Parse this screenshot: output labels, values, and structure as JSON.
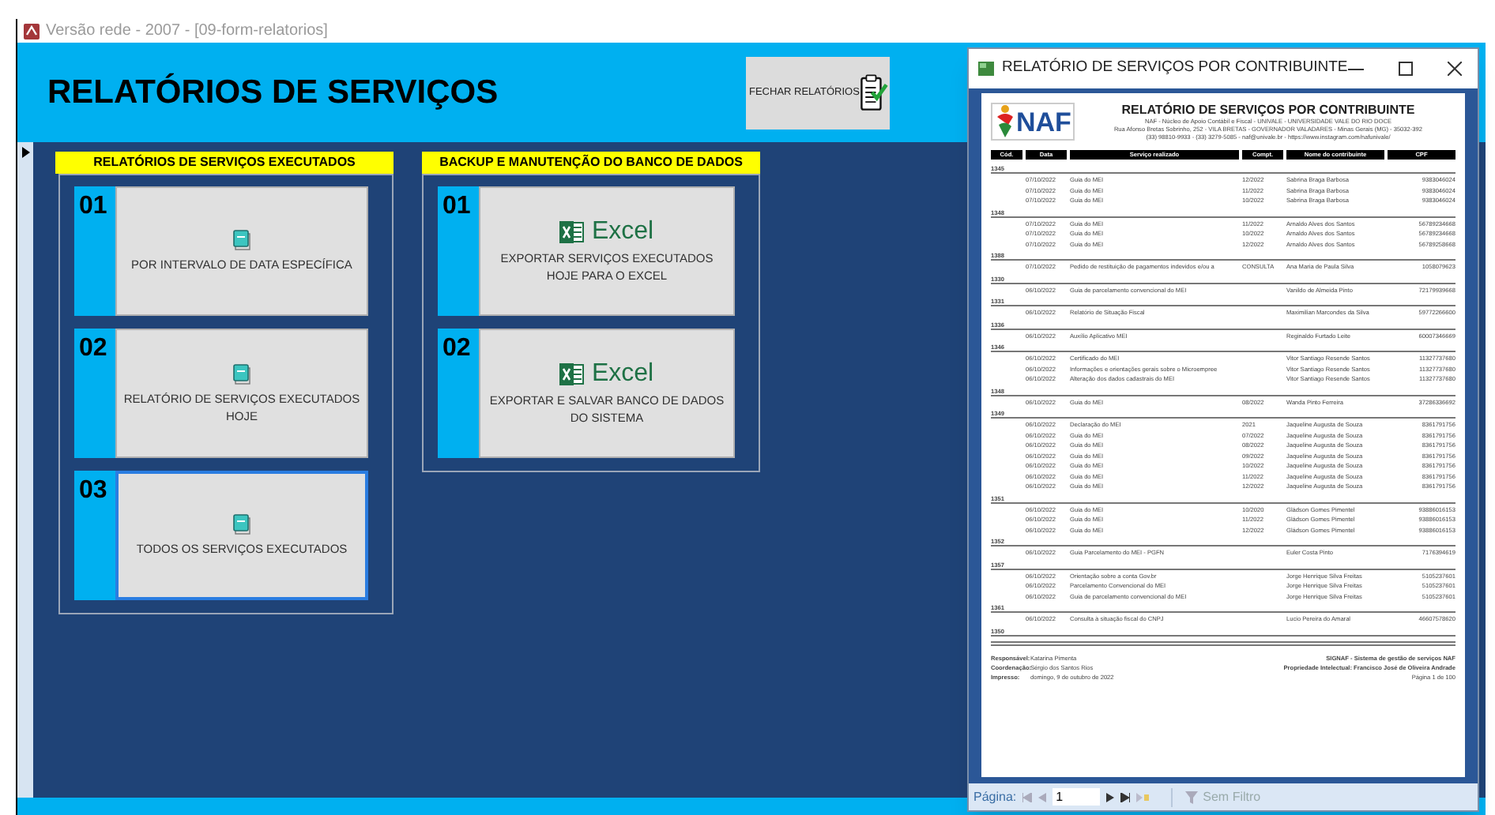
{
  "window": {
    "title": "Versão rede - 2007 - [09-form-relatorios]"
  },
  "header": {
    "title": "RELATÓRIOS DE SERVIÇOS",
    "close_button": "FECHAR RELATÓRIOS"
  },
  "groups": [
    {
      "title": "RELATÓRIOS DE SERVIÇOS EXECUTADOS",
      "buttons": [
        {
          "number": "01",
          "kind": "report",
          "label": "POR INTERVALO DE DATA ESPECÍFICA",
          "focused": false
        },
        {
          "number": "02",
          "kind": "report",
          "label": "RELATÓRIO DE SERVIÇOS EXECUTADOS HOJE",
          "focused": false
        },
        {
          "number": "03",
          "kind": "report",
          "label": "TODOS OS SERVIÇOS EXECUTADOS",
          "focused": true
        }
      ]
    },
    {
      "title": "BACKUP E MANUTENÇÃO DO BANCO DE DADOS",
      "buttons": [
        {
          "number": "01",
          "kind": "excel",
          "brand": "Excel",
          "label": "EXPORTAR SERVIÇOS EXECUTADOS HOJE PARA O EXCEL",
          "focused": false
        },
        {
          "number": "02",
          "kind": "excel",
          "brand": "Excel",
          "label": "EXPORTAR E SALVAR BANCO DE DADOS DO SISTEMA",
          "focused": false
        }
      ]
    }
  ],
  "report_window": {
    "title": "RELATÓRIO DE SERVIÇOS POR CONTRIBUINTE",
    "report": {
      "logo_text": "NAF",
      "title": "RELATÓRIO DE SERVIÇOS POR CONTRIBUINTE",
      "info": [
        "NAF - Núcleo de Apoio Contábil e Fiscal - UNIVALE - UNIVERSIDADE VALE DO RIO DOCE",
        "Rua Afonso Bretas Sobrinho, 252 - VILA BRETAS - GOVERNADOR VALADARES - Minas Gerais (MG) - 35032-392",
        "(33) 98810-9933 - (33) 3279-5085 - naf@univale.br - https://www.instagram.com/nafunivale/"
      ],
      "columns": [
        "Cód.",
        "Data",
        "Serviço realizado",
        "Compt.",
        "Nome do contribuinte",
        "CPF"
      ],
      "groups": [
        {
          "code": "1345",
          "rows": [
            [
              "07/10/2022",
              "Guia do MEI",
              "12/2022",
              "Sabrina Braga Barbosa",
              "9383046024"
            ],
            [
              "07/10/2022",
              "Guia do MEI",
              "11/2022",
              "Sabrina Braga Barbosa",
              "9383046024"
            ],
            [
              "07/10/2022",
              "Guia do MEI",
              "10/2022",
              "Sabrina Braga Barbosa",
              "9383046024"
            ]
          ]
        },
        {
          "code": "1348",
          "rows": [
            [
              "07/10/2022",
              "Guia do MEI",
              "11/2022",
              "Arnaldo Alves dos Santos",
              "56789234668"
            ],
            [
              "07/10/2022",
              "Guia do MEI",
              "10/2022",
              "Arnaldo Alves dos Santos",
              "56789234668"
            ],
            [
              "07/10/2022",
              "Guia do MEI",
              "12/2022",
              "Arnaldo Alves dos Santos",
              "56789258668"
            ]
          ]
        },
        {
          "code": "1388",
          "rows": [
            [
              "07/10/2022",
              "Pedido de restituição de pagamentos indevidos e/ou a",
              "CONSULTA",
              "Ana Maria de Paula Silva",
              "1058079623"
            ]
          ]
        },
        {
          "code": "1330",
          "rows": [
            [
              "06/10/2022",
              "Guia de parcelamento convencional do MEI",
              "",
              "Vanildo de Almeida Pinto",
              "72179939668"
            ]
          ]
        },
        {
          "code": "1331",
          "rows": [
            [
              "06/10/2022",
              "Relatório de Situação Fiscal",
              "",
              "Maximilian Marcondes da Silva",
              "59772266600"
            ]
          ]
        },
        {
          "code": "1336",
          "rows": [
            [
              "06/10/2022",
              "Auxílio Aplicativo MEI",
              "",
              "Reginaldo Furtado Leite",
              "60007346669"
            ]
          ]
        },
        {
          "code": "1346",
          "rows": [
            [
              "06/10/2022",
              "Certificado do MEI",
              "",
              "Vitor Santiago Resende Santos",
              "11327737680"
            ],
            [
              "06/10/2022",
              "Informações e orientações gerais sobre o Microempree",
              "",
              "Vitor Santiago Resende Santos",
              "11327737680"
            ],
            [
              "06/10/2022",
              "Alteração dos dados cadastrais do MEI",
              "",
              "Vitor Santiago Resende Santos",
              "11327737680"
            ]
          ]
        },
        {
          "code": "1348",
          "rows": [
            [
              "06/10/2022",
              "Guia do MEI",
              "08/2022",
              "Wanda Pinto Ferreira",
              "37286336692"
            ]
          ]
        },
        {
          "code": "1349",
          "rows": [
            [
              "06/10/2022",
              "Declaração do MEI",
              "2021",
              "Jaqueline Augusta de Souza",
              "8361791756"
            ],
            [
              "06/10/2022",
              "Guia do MEI",
              "07/2022",
              "Jaqueline Augusta de Souza",
              "8361791756"
            ],
            [
              "06/10/2022",
              "Guia do MEI",
              "08/2022",
              "Jaqueline Augusta de Souza",
              "8361791756"
            ],
            [
              "06/10/2022",
              "Guia do MEI",
              "09/2022",
              "Jaqueline Augusta de Souza",
              "8361791756"
            ],
            [
              "06/10/2022",
              "Guia do MEI",
              "10/2022",
              "Jaqueline Augusta de Souza",
              "8361791756"
            ],
            [
              "06/10/2022",
              "Guia do MEI",
              "11/2022",
              "Jaqueline Augusta de Souza",
              "8361791756"
            ],
            [
              "06/10/2022",
              "Guia do MEI",
              "12/2022",
              "Jaqueline Augusta de Souza",
              "8361791756"
            ]
          ]
        },
        {
          "code": "1351",
          "rows": [
            [
              "06/10/2022",
              "Guia do MEI",
              "10/2020",
              "Gládson Gomes Pimentel",
              "93886016153"
            ],
            [
              "06/10/2022",
              "Guia do MEI",
              "11/2022",
              "Gládson Gomes Pimentel",
              "93886016153"
            ],
            [
              "06/10/2022",
              "Guia do MEI",
              "12/2022",
              "Gládson Gomes Pimentel",
              "93886016153"
            ]
          ]
        },
        {
          "code": "1352",
          "rows": [
            [
              "06/10/2022",
              "Guia Parcelamento do MEI - PGFN",
              "",
              "Euler Costa Pinto",
              "7176394619"
            ]
          ]
        },
        {
          "code": "1357",
          "rows": [
            [
              "06/10/2022",
              "Orientação sobre a conta Gov.br",
              "",
              "Jorge Henrique Silva Freitas",
              "5105237601"
            ],
            [
              "06/10/2022",
              "Parcelamento Convencional do MEI",
              "",
              "Jorge Henrique Silva Freitas",
              "5105237601"
            ],
            [
              "06/10/2022",
              "Guia de parcelamento convencional do MEI",
              "",
              "Jorge Henrique Silva Freitas",
              "5105237601"
            ]
          ]
        },
        {
          "code": "1361",
          "rows": [
            [
              "06/10/2022",
              "Consulta à situação fiscal do CNPJ",
              "",
              "Lucio Pereira do Amaral",
              "46607578620"
            ]
          ]
        },
        {
          "code": "1350"
        }
      ],
      "footer_left": [
        {
          "label": "Responsável:",
          "value": "Katarina Pimenta"
        },
        {
          "label": "Coordenação:",
          "value": "Sérgio dos Santos Rios"
        },
        {
          "label": "Impresso:",
          "value": "domingo, 9 de outubro de 2022"
        }
      ],
      "footer_right": [
        "SIGNAF - Sistema de gestão de serviços NAF",
        "Propriedade Intelectual: Francisco José de Oliveira Andrade",
        "Página 1 de 100"
      ]
    },
    "navigation": {
      "label": "Página:",
      "page": "1",
      "filter": "Sem Filtro"
    }
  }
}
